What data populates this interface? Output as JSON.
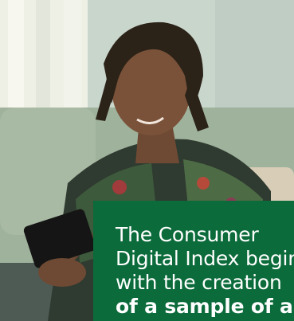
{
  "hero": {
    "image_subject": "man-reading-smartphone-on-sofa",
    "card": {
      "color": "#0b6b3a",
      "lines": [
        "The Consumer",
        "Digital Index begin",
        "with the creation",
        "of a sample of ar"
      ]
    }
  }
}
